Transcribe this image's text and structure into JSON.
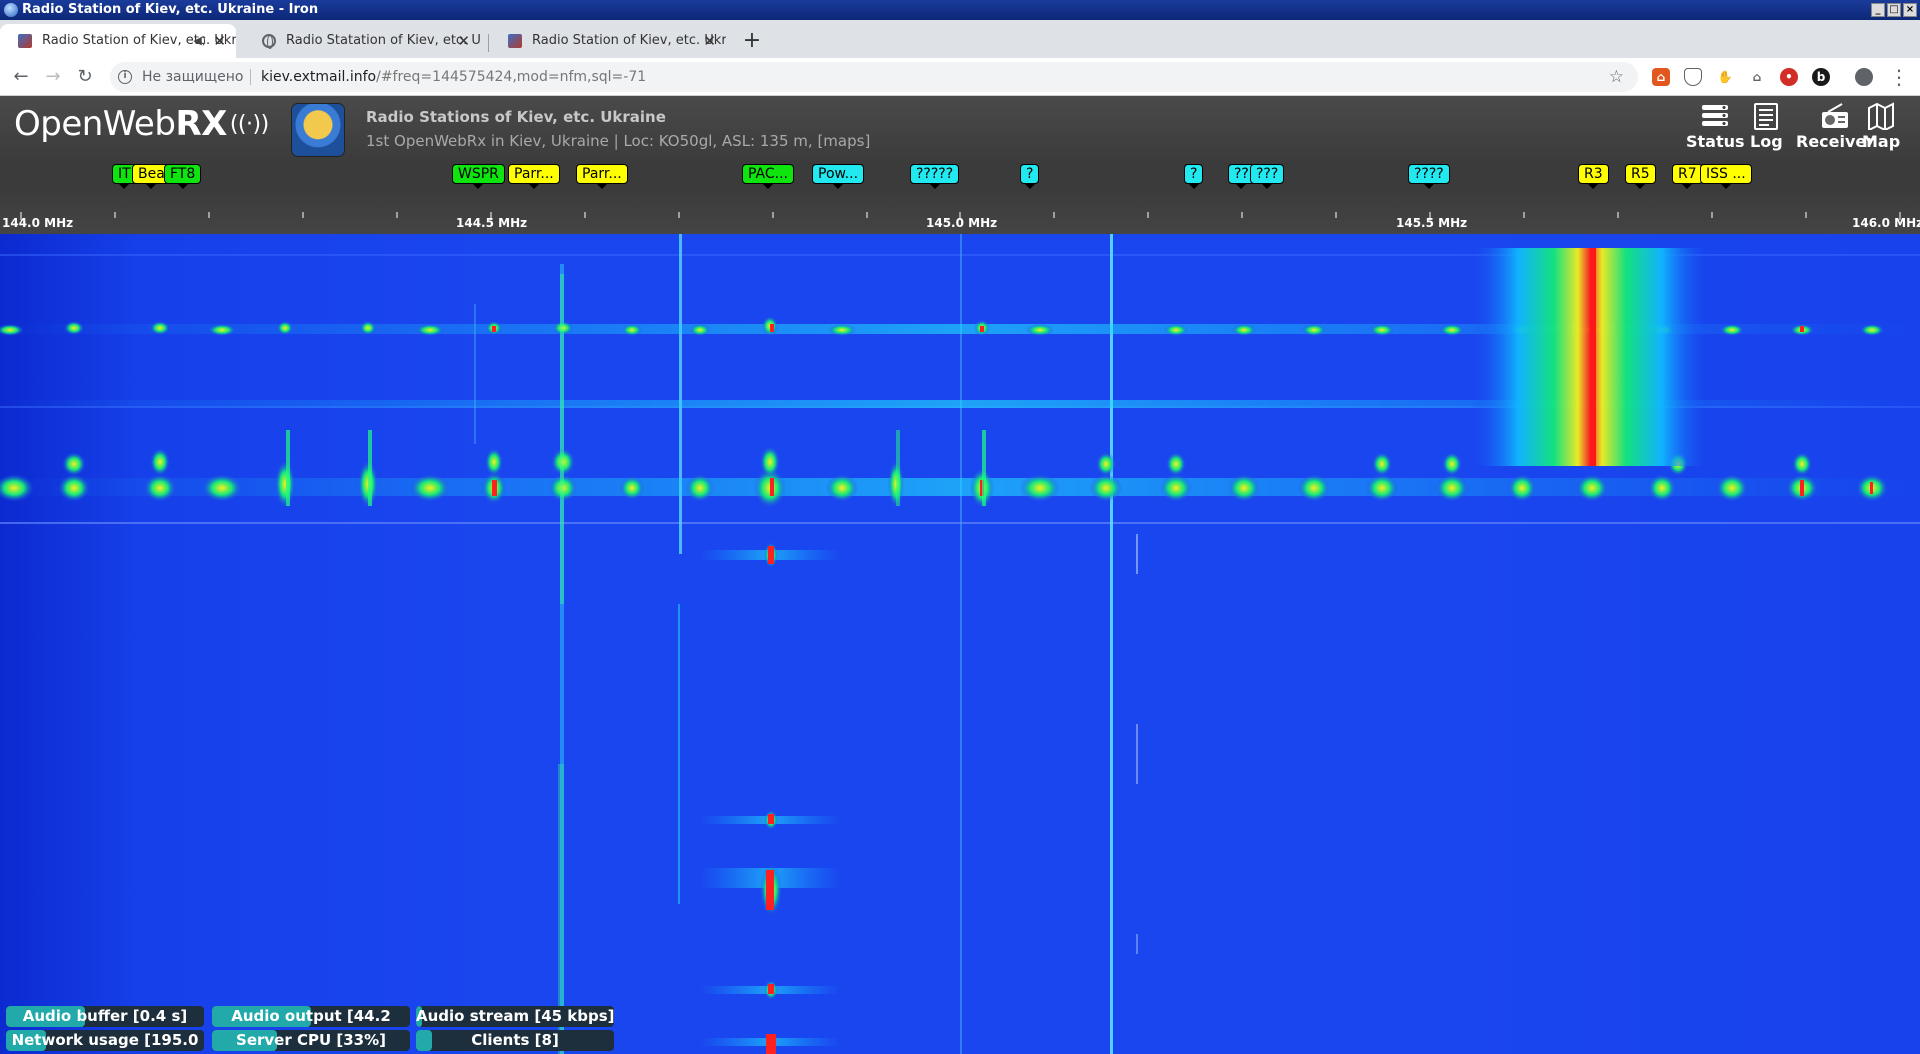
{
  "window": {
    "title": "Radio Station of Kiev, etc. Ukraine - Iron",
    "buttons": [
      "minimize",
      "maximize",
      "close"
    ]
  },
  "tabs": [
    {
      "label": "Radio Station of Kiev, etc. Ukraine - Iron",
      "favicon": "openwebrx-logo-icon",
      "active": true,
      "audio": true
    },
    {
      "label": "Radio Statation of Kiev, etc. Ukraine",
      "favicon": "globe-icon",
      "active": false,
      "audio": false
    },
    {
      "label": "Radio Station of Kiev, etc. Ukraine - Iron",
      "favicon": "openwebrx-logo-icon",
      "active": false,
      "audio": false
    }
  ],
  "toolbar": {
    "security_text": "Не защищено",
    "url_host": "kiev.extmail.info",
    "url_rest": "/#freq=144575424,mod=nfm,sql=-71",
    "extensions": [
      {
        "name": "house-extension-icon",
        "color": "#e2571e"
      },
      {
        "name": "shield-extension-icon",
        "color": "#5f6368"
      },
      {
        "name": "hand-extension-icon",
        "color": "#9aa0a6"
      },
      {
        "name": "home-extension-icon",
        "color": "#5f6368"
      },
      {
        "name": "lastpass-extension-icon",
        "color": "#d32d27"
      },
      {
        "name": "b-extension-icon",
        "color": "#1a1a1a"
      }
    ]
  },
  "header": {
    "logo_light": "OpenWeb",
    "logo_bold": "RX",
    "receiver_title": "Radio Stations of Kiev, etc. Ukraine",
    "receiver_desc": "1st OpenWebRx in Kiev, Ukraine | Loc: KO50gl, ASL: 135 m,",
    "maps_link": "[maps]",
    "panels": [
      {
        "label": "Status",
        "icon": "status-icon"
      },
      {
        "label": "Log",
        "icon": "log-icon"
      },
      {
        "label": "Receiver",
        "icon": "radio-icon"
      },
      {
        "label": "Map",
        "icon": "map-icon"
      }
    ]
  },
  "bookmarks": [
    {
      "label": "IT",
      "color": "green"
    },
    {
      "label": "Bea",
      "color": "yellow"
    },
    {
      "label": "FT8",
      "color": "green"
    },
    {
      "label": "WSPR",
      "color": "green"
    },
    {
      "label": "Parr...",
      "color": "yellow"
    },
    {
      "label": "Parr...",
      "color": "yellow"
    },
    {
      "label": "PAC...",
      "color": "green"
    },
    {
      "label": "Pow...",
      "color": "cyan"
    },
    {
      "label": "?????",
      "color": "cyan"
    },
    {
      "label": "?",
      "color": "cyan"
    },
    {
      "label": "?",
      "color": "cyan"
    },
    {
      "label": "??",
      "color": "cyan"
    },
    {
      "label": "???",
      "color": "cyan"
    },
    {
      "label": "????",
      "color": "cyan"
    },
    {
      "label": "R3",
      "color": "yellow"
    },
    {
      "label": "R5",
      "color": "yellow"
    },
    {
      "label": "R7",
      "color": "yellow"
    },
    {
      "label": "ISS ...",
      "color": "yellow"
    }
  ],
  "tuner_symbol": "⩘",
  "scale": {
    "labels": [
      "144.0 MHz",
      "144.5 MHz",
      "145.0 MHz",
      "145.5 MHz",
      "146.0 MHz"
    ]
  },
  "status_bars": [
    {
      "label": "Audio buffer [0.4 s]",
      "fill_percent": 40
    },
    {
      "label": "Audio output [44.2",
      "fill_percent": 50
    },
    {
      "label": "Audio stream [45 kbps]",
      "fill_percent": 3
    },
    {
      "label": "Network usage [195.0",
      "fill_percent": 20
    },
    {
      "label": "Server CPU [33%]",
      "fill_percent": 33
    },
    {
      "label": "Clients [8]",
      "fill_percent": 8
    }
  ]
}
